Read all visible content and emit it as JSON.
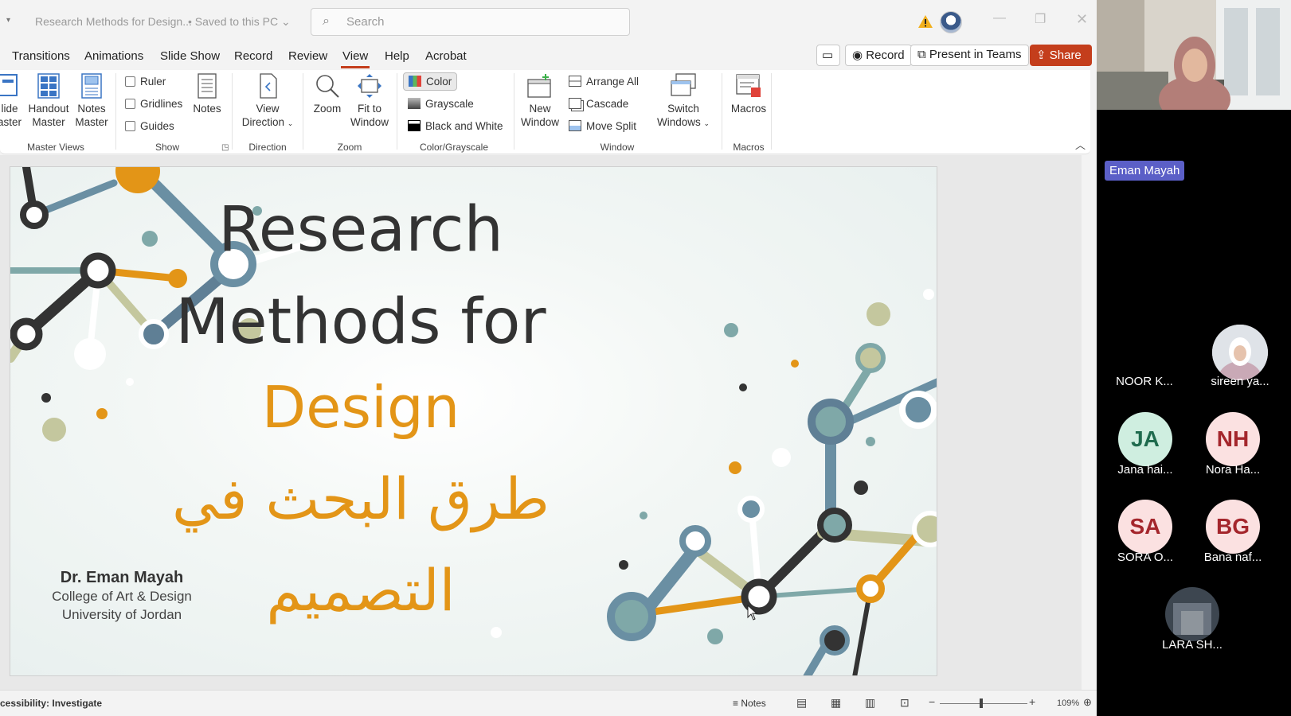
{
  "titlebar": {
    "doc_title": "Research Methods for Design...",
    "saved_status": "• Saved to this PC",
    "search_placeholder": "Search"
  },
  "tabs": [
    "Transitions",
    "Animations",
    "Slide Show",
    "Record",
    "Review",
    "View",
    "Help",
    "Acrobat"
  ],
  "active_tab": "View",
  "top_buttons": {
    "record": "Record",
    "present": "Present in Teams",
    "share": "Share"
  },
  "ribbon": {
    "master_views": {
      "slide_master": [
        "lide",
        "aster"
      ],
      "handout_master": [
        "Handout",
        "Master"
      ],
      "notes_master": [
        "Notes",
        "Master"
      ],
      "label": "Master Views"
    },
    "show": {
      "ruler": "Ruler",
      "gridlines": "Gridlines",
      "guides": "Guides",
      "notes": "Notes",
      "label": "Show"
    },
    "direction": {
      "view_direction": [
        "View",
        "Direction"
      ],
      "label": "Direction"
    },
    "zoom": {
      "zoom": "Zoom",
      "fit": [
        "Fit to",
        "Window"
      ],
      "label": "Zoom"
    },
    "color": {
      "color": "Color",
      "grayscale": "Grayscale",
      "bw": "Black and White",
      "label": "Color/Grayscale"
    },
    "window": {
      "new_window": [
        "New",
        "Window"
      ],
      "arrange_all": "Arrange All",
      "cascade": "Cascade",
      "move_split": "Move Split",
      "switch": [
        "Switch",
        "Windows"
      ],
      "label": "Window"
    },
    "macros": {
      "macros": "Macros",
      "label": "Macros"
    }
  },
  "slide": {
    "title_line1": "Research",
    "title_line2": "Methods for",
    "title_line3": "Design",
    "arabic_line1": "طرق البحث في",
    "arabic_line2": "التصميم",
    "author_name": "Dr. Eman Mayah",
    "author_college": "College of Art & Design",
    "author_uni": "University of Jordan"
  },
  "status": {
    "accessibility": "cessibility: Investigate",
    "notes": "Notes",
    "zoom": "109%"
  },
  "teams": {
    "presenter": "Eman Mayah",
    "participants": [
      {
        "initials": "",
        "name": "NOOR K..."
      },
      {
        "initials": "",
        "name": "sireen ya..."
      },
      {
        "initials": "JA",
        "name": "Jana hai..."
      },
      {
        "initials": "NH",
        "name": "Nora Ha..."
      },
      {
        "initials": "SA",
        "name": "SORA O..."
      },
      {
        "initials": "BG",
        "name": "Bana naf..."
      },
      {
        "initials": "",
        "name": "LARA SH..."
      }
    ]
  },
  "colors": {
    "accent": "#c43e1c",
    "orange": "#e39517",
    "teams_badge": "#5b5fc7"
  }
}
